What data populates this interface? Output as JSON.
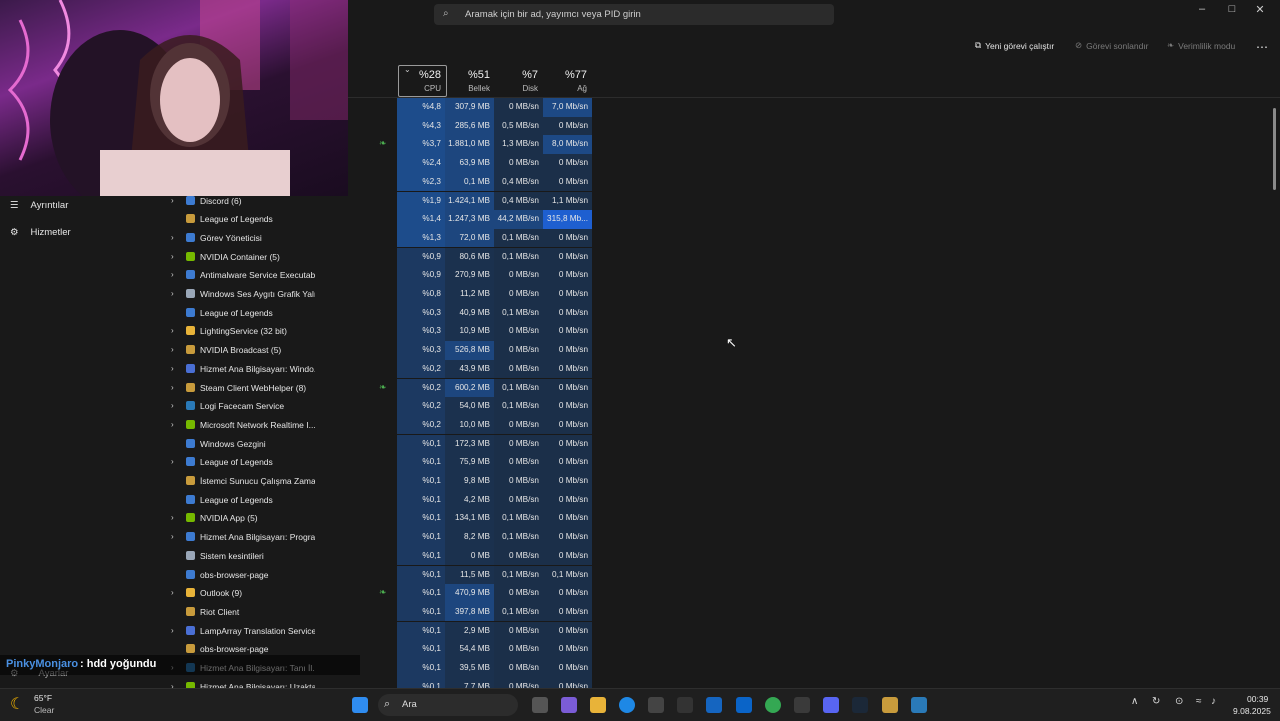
{
  "search": {
    "placeholder": "Aramak için bir ad, yayımcı veya PID girin"
  },
  "toolbar": {
    "run_new": "Yeni görevi çalıştır",
    "end_task": "Görevi sonlandır",
    "efficiency": "Verimlilik modu",
    "more": "⋯"
  },
  "headers": {
    "cpu": {
      "pct": "%28",
      "label": "CPU"
    },
    "memory": {
      "pct": "%51",
      "label": "Bellek"
    },
    "disk": {
      "pct": "%7",
      "label": "Disk"
    },
    "network": {
      "pct": "%77",
      "label": "Ağ"
    }
  },
  "sidebar": {
    "details": "Ayrıntılar",
    "services": "Hizmetler",
    "settings": "Ayarlar"
  },
  "rows": [
    {
      "name": "",
      "cpu": "%4,8",
      "mem": "307,9 MB",
      "disk": "0 MB/sn",
      "net": "7,0 Mb/sn"
    },
    {
      "name": "",
      "cpu": "%4,3",
      "mem": "285,6 MB",
      "disk": "0,5 MB/sn",
      "net": "0 Mb/sn"
    },
    {
      "name": "",
      "cpu": "%3,7",
      "mem": "1.881,0 MB",
      "disk": "1,3 MB/sn",
      "net": "8,0 Mb/sn"
    },
    {
      "name": "",
      "cpu": "%2,4",
      "mem": "63,9 MB",
      "disk": "0 MB/sn",
      "net": "0 Mb/sn"
    },
    {
      "name": "",
      "cpu": "%2,3",
      "mem": "0,1 MB",
      "disk": "0,4 MB/sn",
      "net": "0 Mb/sn"
    },
    {
      "name": "Discord (6)",
      "cpu": "%1,9",
      "mem": "1.424,1 MB",
      "disk": "0,4 MB/sn",
      "net": "1,1 Mb/sn"
    },
    {
      "name": "League of Legends",
      "cpu": "%1,4",
      "mem": "1.247,3 MB",
      "disk": "44,2 MB/sn",
      "net": "315,8 Mb..."
    },
    {
      "name": "Görev Yöneticisi",
      "cpu": "%1,3",
      "mem": "72,0 MB",
      "disk": "0,1 MB/sn",
      "net": "0 Mb/sn"
    },
    {
      "name": "NVIDIA Container (5)",
      "cpu": "%0,9",
      "mem": "80,6 MB",
      "disk": "0,1 MB/sn",
      "net": "0 Mb/sn"
    },
    {
      "name": "Antimalware Service Executable",
      "cpu": "%0,9",
      "mem": "270,9 MB",
      "disk": "0 MB/sn",
      "net": "0 Mb/sn"
    },
    {
      "name": "Windows Ses Aygıtı Grafik Yalı...",
      "cpu": "%0,8",
      "mem": "11,2 MB",
      "disk": "0 MB/sn",
      "net": "0 Mb/sn"
    },
    {
      "name": "League of Legends",
      "cpu": "%0,3",
      "mem": "40,9 MB",
      "disk": "0,1 MB/sn",
      "net": "0 Mb/sn"
    },
    {
      "name": "LightingService (32 bit)",
      "cpu": "%0,3",
      "mem": "10,9 MB",
      "disk": "0 MB/sn",
      "net": "0 Mb/sn"
    },
    {
      "name": "NVIDIA Broadcast (5)",
      "cpu": "%0,3",
      "mem": "526,8 MB",
      "disk": "0 MB/sn",
      "net": "0 Mb/sn"
    },
    {
      "name": "Hizmet Ana Bilgisayarı: Windo...",
      "cpu": "%0,2",
      "mem": "43,9 MB",
      "disk": "0 MB/sn",
      "net": "0 Mb/sn"
    },
    {
      "name": "Steam Client WebHelper (8)",
      "cpu": "%0,2",
      "mem": "600,2 MB",
      "disk": "0,1 MB/sn",
      "net": "0 Mb/sn"
    },
    {
      "name": "Logi Facecam Service",
      "cpu": "%0,2",
      "mem": "54,0 MB",
      "disk": "0,1 MB/sn",
      "net": "0 Mb/sn"
    },
    {
      "name": "Microsoft Network Realtime I...",
      "cpu": "%0,2",
      "mem": "10,0 MB",
      "disk": "0 MB/sn",
      "net": "0 Mb/sn"
    },
    {
      "name": "Windows Gezgini",
      "cpu": "%0,1",
      "mem": "172,3 MB",
      "disk": "0 MB/sn",
      "net": "0 Mb/sn"
    },
    {
      "name": "League of Legends",
      "cpu": "%0,1",
      "mem": "75,9 MB",
      "disk": "0 MB/sn",
      "net": "0 Mb/sn"
    },
    {
      "name": "İstemci Sunucu Çalışma Zama...",
      "cpu": "%0,1",
      "mem": "9,8 MB",
      "disk": "0 MB/sn",
      "net": "0 Mb/sn"
    },
    {
      "name": "League of Legends",
      "cpu": "%0,1",
      "mem": "4,2 MB",
      "disk": "0 MB/sn",
      "net": "0 Mb/sn"
    },
    {
      "name": "NVIDIA App (5)",
      "cpu": "%0,1",
      "mem": "134,1 MB",
      "disk": "0,1 MB/sn",
      "net": "0 Mb/sn"
    },
    {
      "name": "Hizmet Ana Bilgisayarı: Progra...",
      "cpu": "%0,1",
      "mem": "8,2 MB",
      "disk": "0,1 MB/sn",
      "net": "0 Mb/sn"
    },
    {
      "name": "Sistem kesintileri",
      "cpu": "%0,1",
      "mem": "0 MB",
      "disk": "0 MB/sn",
      "net": "0 Mb/sn"
    },
    {
      "name": "obs-browser-page",
      "cpu": "%0,1",
      "mem": "11,5 MB",
      "disk": "0,1 MB/sn",
      "net": "0,1 Mb/sn"
    },
    {
      "name": "Outlook (9)",
      "cpu": "%0,1",
      "mem": "470,9 MB",
      "disk": "0 MB/sn",
      "net": "0 Mb/sn"
    },
    {
      "name": "Riot Client",
      "cpu": "%0,1",
      "mem": "397,8 MB",
      "disk": "0,1 MB/sn",
      "net": "0 Mb/sn"
    },
    {
      "name": "LampArray Translation Service",
      "cpu": "%0,1",
      "mem": "2,9 MB",
      "disk": "0 MB/sn",
      "net": "0 Mb/sn"
    },
    {
      "name": "obs-browser-page",
      "cpu": "%0,1",
      "mem": "54,4 MB",
      "disk": "0 MB/sn",
      "net": "0 Mb/sn"
    },
    {
      "name": "Hizmet Ana Bilgisayarı: Tanı İl...",
      "cpu": "%0,1",
      "mem": "39,5 MB",
      "disk": "0 MB/sn",
      "net": "0 Mb/sn"
    },
    {
      "name": "Hizmet Ana Bilgisayarı: Uzakta...",
      "cpu": "%0,1",
      "mem": "7,7 MB",
      "disk": "0 MB/sn",
      "net": "0 Mb/sn"
    }
  ],
  "chat": {
    "user": "PinkyMonjaro",
    "message": " : hdd yoğundu"
  },
  "taskbar": {
    "weather_temp": "65°F",
    "weather_desc": "Clear",
    "search_label": "Ara",
    "time": "00:39",
    "date": "9.08.2025"
  },
  "colors": {
    "accent": "#1e4f91",
    "mem_highlight": "#1e4f91",
    "cpu_strong": "#1d4c8a",
    "chat_user": "#3b82f6"
  }
}
